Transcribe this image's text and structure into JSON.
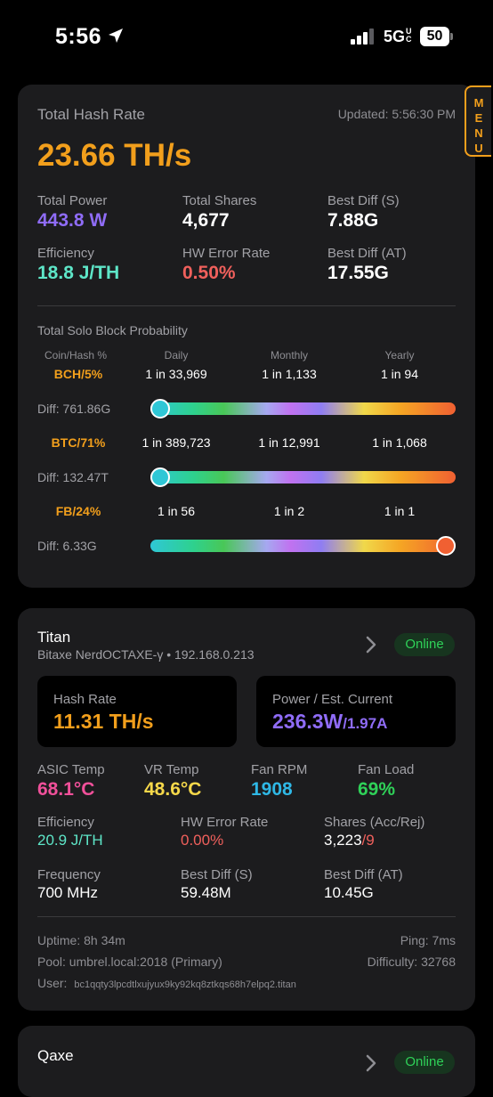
{
  "status_bar": {
    "time": "5:56",
    "network": "5G",
    "network_sup": "UC",
    "battery": "50"
  },
  "menu": {
    "letters": [
      "M",
      "E",
      "N",
      "U"
    ]
  },
  "summary": {
    "title": "Total Hash Rate",
    "updated": "Updated: 5:56:30 PM",
    "hash_rate": "23.66 TH/s",
    "stats": [
      {
        "label": "Total Power",
        "value": "443.8 W",
        "color": "#8f6cf7"
      },
      {
        "label": "Total Shares",
        "value": "4,677",
        "color": "#ffffff"
      },
      {
        "label": "Best Diff (S)",
        "value": "7.88G",
        "color": "#ffffff"
      },
      {
        "label": "Efficiency",
        "value": "18.8 J/TH",
        "color": "#5ee6c8"
      },
      {
        "label": "HW Error Rate",
        "value": "0.50%",
        "color": "#f0605c"
      },
      {
        "label": "Best Diff (AT)",
        "value": "17.55G",
        "color": "#ffffff"
      }
    ],
    "probability_title": "Total Solo Block Probability",
    "columns": [
      "Coin/Hash %",
      "Daily",
      "Monthly",
      "Yearly"
    ],
    "coins": [
      {
        "coin": "BCH/5%",
        "daily": "1 in 33,969",
        "monthly": "1 in 1,133",
        "yearly": "1 in 94",
        "diff": "Diff: 761.86G",
        "slider_level": 0.0
      },
      {
        "coin": "BTC/71%",
        "daily": "1 in 389,723",
        "monthly": "1 in 12,991",
        "yearly": "1 in 1,068",
        "diff": "Diff: 132.47T",
        "slider_level": 0.0
      },
      {
        "coin": "FB/24%",
        "daily": "1 in 56",
        "monthly": "1 in 2",
        "yearly": "1 in 1",
        "diff": "Diff: 6.33G",
        "slider_level": 1.0
      }
    ]
  },
  "miner": {
    "name": "Titan",
    "subtitle": "Bitaxe NerdOCTAXE-γ • 192.168.0.213",
    "status": "Online",
    "hash_rate_label": "Hash Rate",
    "hash_rate": "11.31 TH/s",
    "power_label": "Power / Est. Current",
    "power": "236.3W",
    "current": "/1.97A",
    "temps": [
      {
        "label": "ASIC Temp",
        "value": "68.1°C",
        "color": "#f0509a"
      },
      {
        "label": "VR Temp",
        "value": "48.6°C",
        "color": "#f6d84a"
      },
      {
        "label": "Fan RPM",
        "value": "1908",
        "color": "#2fb8e6"
      },
      {
        "label": "Fan Load",
        "value": "69%",
        "color": "#2fd158"
      }
    ],
    "efficiency_label": "Efficiency",
    "efficiency": "20.9 J/TH",
    "hw_error_label": "HW Error Rate",
    "hw_error": "0.00%",
    "shares_label": "Shares (Acc/Rej)",
    "shares_acc": "3,223",
    "shares_rej": "/9",
    "frequency_label": "Frequency",
    "frequency": "700 MHz",
    "best_diff_s_label": "Best Diff (S)",
    "best_diff_s": "59.48M",
    "best_diff_at_label": "Best Diff (AT)",
    "best_diff_at": "10.45G",
    "uptime": "Uptime: 8h 34m",
    "ping": "Ping: 7ms",
    "pool": "Pool: umbrel.local:2018 (Primary)",
    "difficulty": "Difficulty: 32768",
    "user_label": "User:",
    "user": "bc1qqty3lpcdtlxujyux9ky92kq8ztkqs68h7elpq2.titan"
  },
  "miner2": {
    "name": "Qaxe",
    "status": "Online"
  },
  "colors": {
    "accent": "#f29f1c",
    "card": "#1c1c1e",
    "online": "#2fd158"
  }
}
